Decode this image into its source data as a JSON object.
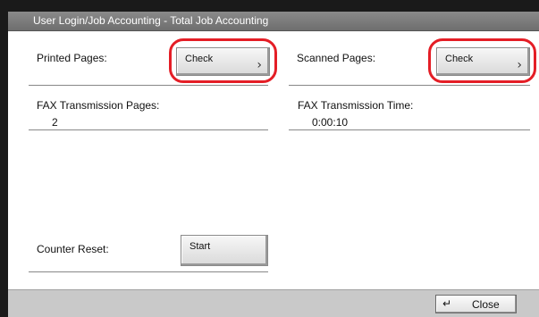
{
  "window": {
    "title": "User Login/Job Accounting - Total Job Accounting"
  },
  "printed_pages": {
    "label": "Printed Pages:",
    "button_label": "Check",
    "icon": "chevron-right-icon"
  },
  "scanned_pages": {
    "label": "Scanned Pages:",
    "button_label": "Check",
    "icon": "chevron-right-icon"
  },
  "fax_transmission_pages": {
    "label": "FAX Transmission Pages:",
    "value": "2"
  },
  "fax_transmission_time": {
    "label": "FAX Transmission Time:",
    "value": "0:00:10"
  },
  "counter_reset": {
    "label": "Counter Reset:",
    "button_label": "Start"
  },
  "footer": {
    "close_label": "Close",
    "close_icon": "enter-icon"
  },
  "colors": {
    "highlight_ring": "#e41e26",
    "title_bar": "#7a7a7a",
    "footer": "#c9c9c9"
  }
}
